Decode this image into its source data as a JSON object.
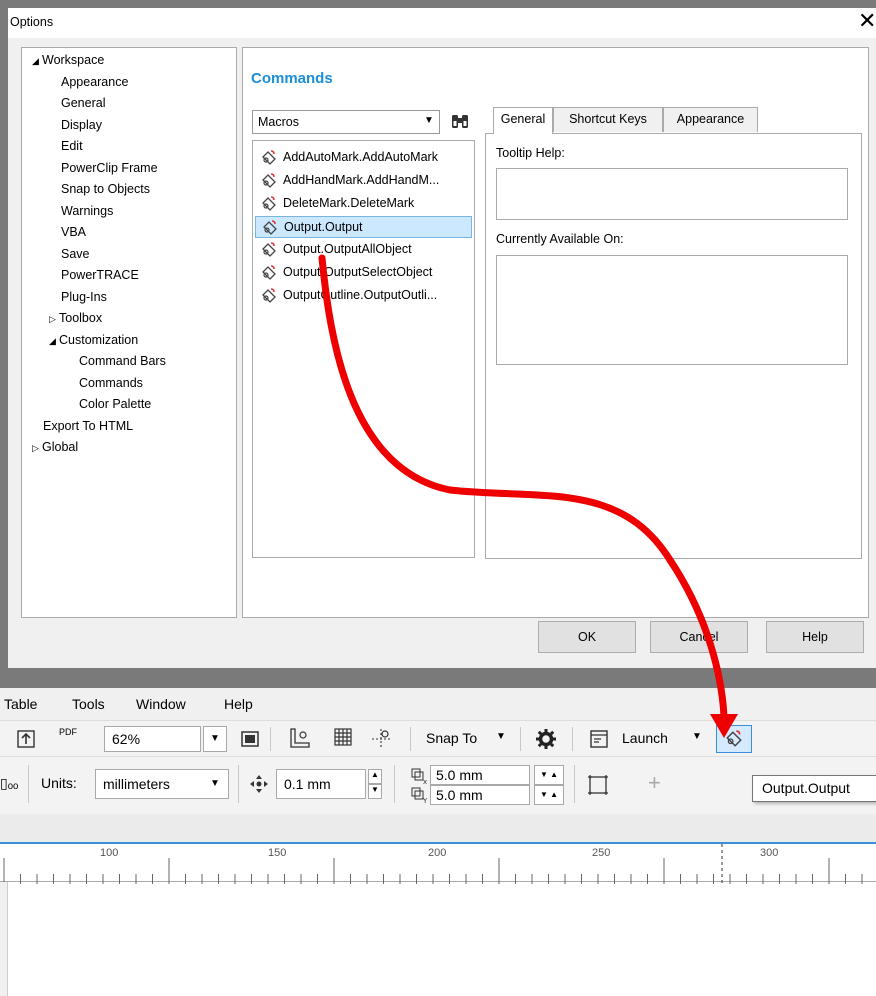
{
  "dialog": {
    "title": "Options",
    "close_glyph": "✕",
    "tree": [
      {
        "label": "Workspace",
        "toggle": "◢"
      },
      {
        "label": "Appearance"
      },
      {
        "label": "General"
      },
      {
        "label": "Display"
      },
      {
        "label": "Edit"
      },
      {
        "label": "PowerClip Frame"
      },
      {
        "label": "Snap to Objects"
      },
      {
        "label": "Warnings"
      },
      {
        "label": "VBA"
      },
      {
        "label": "Save"
      },
      {
        "label": "PowerTRACE"
      },
      {
        "label": "Plug-Ins"
      },
      {
        "label": "Toolbox",
        "toggle": "▷"
      },
      {
        "label": "Customization",
        "toggle": "◢"
      },
      {
        "label": "Command Bars"
      },
      {
        "label": "Commands"
      },
      {
        "label": "Color Palette"
      },
      {
        "label": "Export To HTML"
      },
      {
        "label": "Global",
        "toggle": "▷"
      }
    ],
    "section_title": "Commands",
    "category_select": {
      "value": "Macros",
      "arrow": "▼"
    },
    "commands": [
      "AddAutoMark.AddAutoMark",
      "AddHandMark.AddHandM...",
      "DeleteMark.DeleteMark",
      "Output.Output",
      "Output.OutputAllObject",
      "Output.OutputSelectObject",
      "OutputOutline.OutputOutli..."
    ],
    "selected_command": "Output.Output",
    "tabs": [
      "General",
      "Shortcut Keys",
      "Appearance"
    ],
    "active_tab": "General",
    "tooltip_help_label": "Tooltip Help:",
    "available_on_label": "Currently Available On:",
    "buttons": {
      "ok": "OK",
      "cancel": "Cancel",
      "help": "Help"
    }
  },
  "app": {
    "menu": [
      "Table",
      "Tools",
      "Window",
      "Help"
    ],
    "toolbar1": {
      "pdf_label": "PDF",
      "zoom": "62%",
      "dropdown_arrow": "▼",
      "snap_to": "Snap To",
      "launch": "Launch"
    },
    "toolbar2": {
      "units_label": "Units:",
      "units_value": "millimeters",
      "nudge": "0.1 mm",
      "dup_x": "5.0 mm",
      "dup_y": "5.0 mm",
      "spin_up": "▲",
      "spin_down": "▼",
      "add_glyph": "+",
      "x_sub": "x",
      "y_sub": "Y"
    },
    "ruler_numbers": [
      "100",
      "150",
      "200",
      "250",
      "300"
    ],
    "tooltip": "Output.Output"
  },
  "colors": {
    "accent": "#1a8fd6",
    "selection": "#cce8ff",
    "arrow": "#ee0000",
    "ruler_line": "#3b8fd9"
  }
}
